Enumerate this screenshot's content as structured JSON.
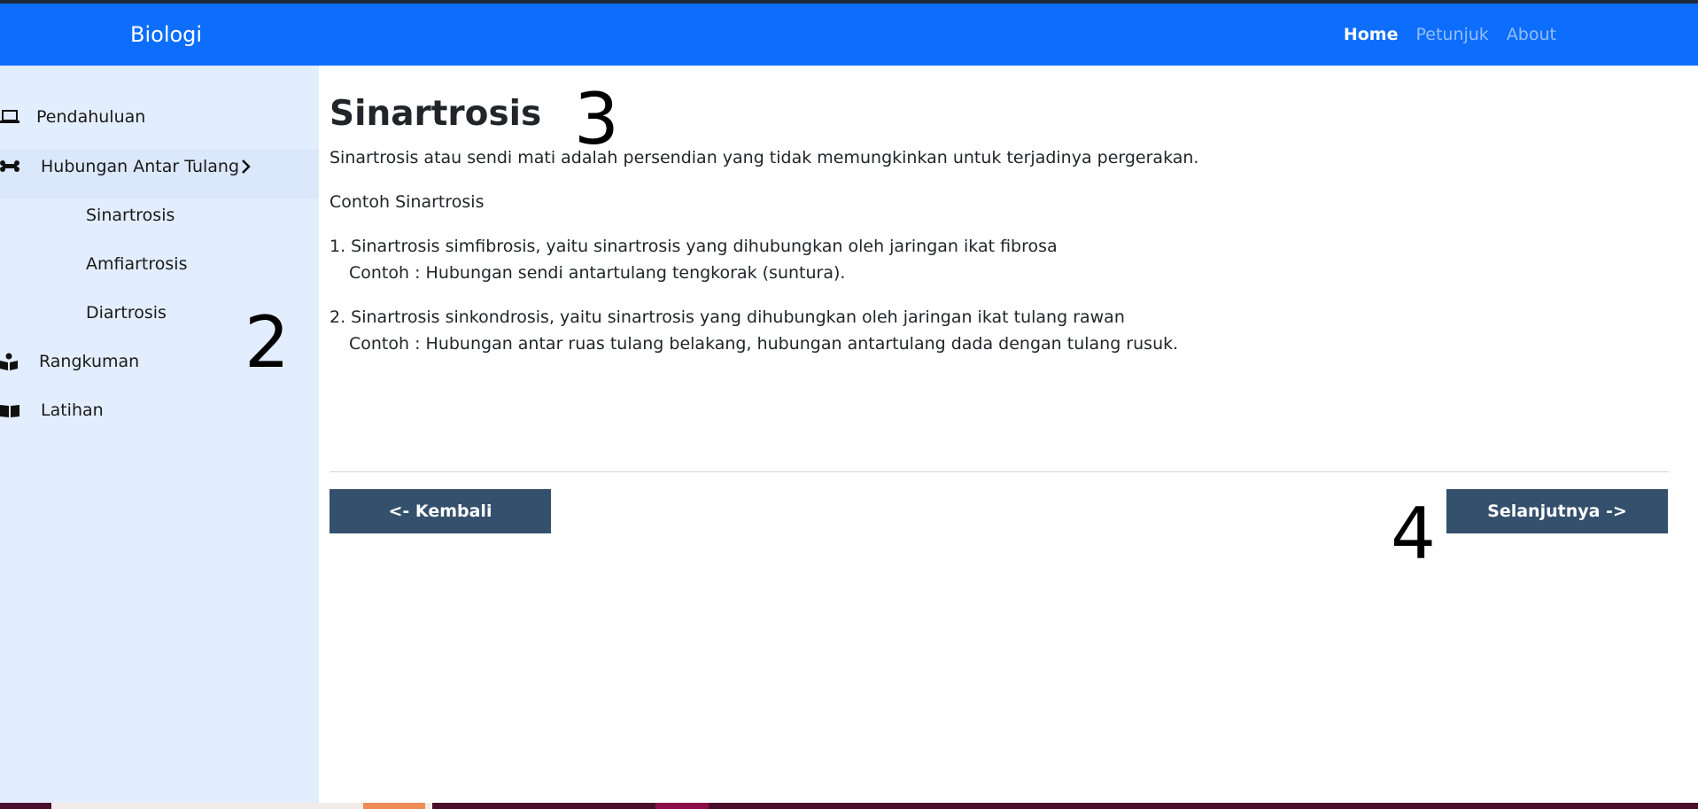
{
  "navbar": {
    "brand": "Biologi",
    "links": [
      {
        "label": "Home",
        "active": true
      },
      {
        "label": "Petunjuk",
        "active": false
      },
      {
        "label": "About",
        "active": false
      }
    ],
    "bg_color": "#0d6efd"
  },
  "sidebar": {
    "items": [
      {
        "label": "Pendahuluan",
        "icon": "laptop-icon"
      },
      {
        "label": "Hubungan Antar Tulang",
        "icon": "bone-icon"
      },
      {
        "label": "Rangkuman",
        "icon": "reading-icon"
      },
      {
        "label": "Latihan",
        "icon": "book-icon"
      }
    ],
    "subitems": [
      {
        "label": "Sinartrosis"
      },
      {
        "label": "Amfiartrosis"
      },
      {
        "label": "Diartrosis"
      }
    ],
    "bg_color": "#e2edfe"
  },
  "annotations": [
    "2",
    "3",
    "4"
  ],
  "main": {
    "title": "Sinartrosis",
    "intro": "Sinartrosis atau sendi mati adalah persendian yang tidak memungkinkan untuk terjadinya pergerakan.",
    "subheading": "Contoh Sinartrosis",
    "list": [
      {
        "text": "1. Sinartrosis simfibrosis, yaitu sinartrosis yang dihubungkan oleh jaringan ikat fibrosa",
        "example": "Contoh : Hubungan sendi antartulang tengkorak (suntura)."
      },
      {
        "text": "2. Sinartrosis sinkondrosis, yaitu sinartrosis yang dihubungkan oleh jaringan ikat tulang rawan",
        "example": "Contoh : Hubungan antar ruas tulang belakang, hubungan antartulang dada dengan tulang rusuk."
      }
    ]
  },
  "buttons": {
    "back": "<- Kembali",
    "next": "Selanjutnya ->",
    "color": "#34506d"
  }
}
